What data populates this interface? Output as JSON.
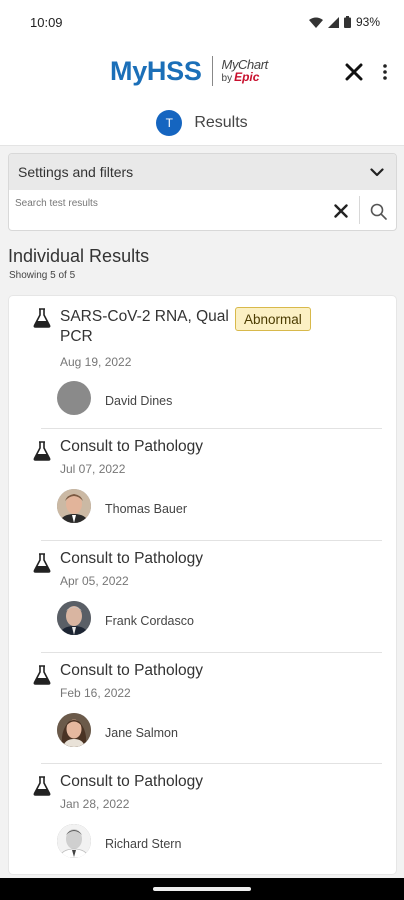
{
  "status_bar": {
    "time": "10:09",
    "battery": "93%"
  },
  "header": {
    "brand": "MyHSS",
    "mychart_label": "MyChart",
    "by_label": "by",
    "epic_label": "Epic",
    "page_title": "Results",
    "avatar_initial": "T"
  },
  "filters": {
    "title": "Settings and filters",
    "search_placeholder": "Search test results",
    "search_value": ""
  },
  "results": {
    "heading": "Individual Results",
    "count": "Showing 5 of 5",
    "items": [
      {
        "title": "SARS-CoV-2 RNA, Qual PCR",
        "date": "Aug 19, 2022",
        "provider": "David Dines",
        "badge": "Abnormal",
        "photo": "placeholder"
      },
      {
        "title": "Consult to Pathology",
        "date": "Jul 07, 2022",
        "provider": "Thomas Bauer",
        "badge": "",
        "photo": "photo"
      },
      {
        "title": "Consult to Pathology",
        "date": "Apr 05, 2022",
        "provider": "Frank Cordasco",
        "badge": "",
        "photo": "photo"
      },
      {
        "title": "Consult to Pathology",
        "date": "Feb 16, 2022",
        "provider": "Jane Salmon",
        "badge": "",
        "photo": "photo"
      },
      {
        "title": "Consult to Pathology",
        "date": "Jan 28, 2022",
        "provider": "Richard Stern",
        "badge": "",
        "photo": "photo"
      }
    ]
  },
  "colors": {
    "brand_blue": "#1b6fb8",
    "epic_red": "#c8102e",
    "badge_bg": "#fbf0c4",
    "badge_border": "#d8b94b"
  }
}
